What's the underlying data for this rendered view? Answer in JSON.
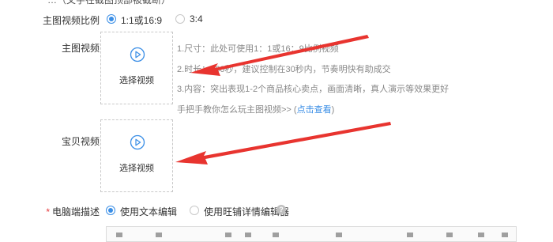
{
  "top_cut_text": "…（文字在截图顶部被截断）",
  "ratio_row": {
    "label": "主图视频比例",
    "options": [
      {
        "label": "1:1或16:9",
        "selected": true
      },
      {
        "label": "3:4",
        "selected": false
      }
    ]
  },
  "main_video": {
    "label": "主图视频",
    "upload_label": "选择视频",
    "icon": "play-circle-icon",
    "tips": [
      "1.尺寸：此处可使用1：1或16：9比例视频",
      "2.时长：≤60秒，建议控制在30秒内，节奏明快有助成交",
      "3.内容：突出表现1-2个商品核心卖点，画面清晰，真人演示等效果更好"
    ],
    "guide_text": "手把手教你怎么玩主图视频>> (",
    "guide_link": "点击查看",
    "guide_suffix": ")"
  },
  "item_video": {
    "label": "宝贝视频",
    "upload_label": "选择视频",
    "icon": "play-circle-icon"
  },
  "desc_row": {
    "label": "电脑端描述",
    "required": true,
    "options": [
      {
        "label": "使用文本编辑",
        "selected": true
      },
      {
        "label": "使用旺铺详情编辑器",
        "selected": false
      }
    ],
    "help_icon": "question-icon"
  },
  "colors": {
    "accent": "#3a8ee6",
    "arrow": "#e8342f",
    "border": "#c8c8c8",
    "required": "#e4393c"
  }
}
